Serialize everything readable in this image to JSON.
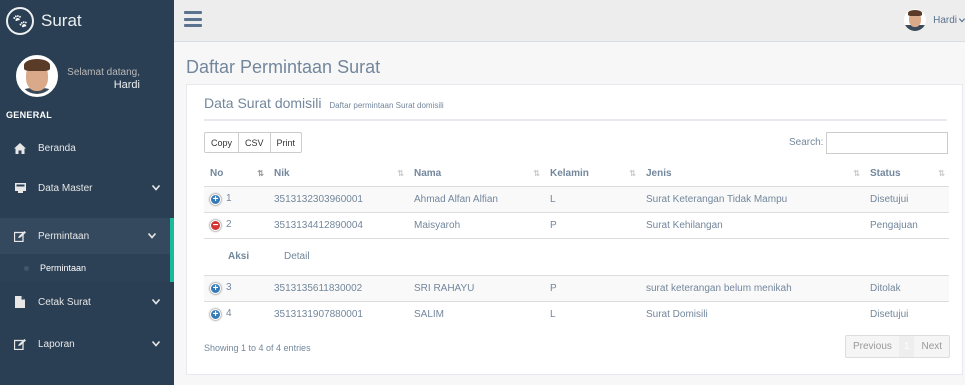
{
  "app": {
    "brand": "Surat",
    "logo_icon": "paw-icon"
  },
  "sidebar": {
    "welcome": "Selamat datang,",
    "username": "Hardi",
    "section": "GENERAL",
    "items": [
      {
        "label": "Beranda",
        "icon": "home-icon"
      },
      {
        "label": "Data Master",
        "icon": "desktop-icon"
      },
      {
        "label": "Permintaan",
        "icon": "edit-icon"
      },
      {
        "label": "Cetak Surat",
        "icon": "file-icon"
      },
      {
        "label": "Laporan",
        "icon": "edit-icon"
      }
    ],
    "sub_items": [
      {
        "label": "Permintaan"
      }
    ]
  },
  "topnav": {
    "user": "Hardi"
  },
  "page": {
    "title": "Daftar Permintaan Surat"
  },
  "panel": {
    "title": "Data Surat domisili",
    "subtitle": "Daftar permintaan Surat domisili",
    "buttons": [
      "Copy",
      "CSV",
      "Print"
    ],
    "search_label": "Search:"
  },
  "table": {
    "columns": [
      "No",
      "Nik",
      "Nama",
      "Kelamin",
      "Jenis",
      "Status"
    ],
    "rows": [
      {
        "no": "1",
        "nik": "3513132303960001",
        "nama": "Ahmad Alfan Alfian",
        "kelamin": "L",
        "jenis": "Surat Keterangan Tidak Mampu",
        "status": "Disetujui"
      },
      {
        "no": "2",
        "nik": "3513134412890004",
        "nama": "Maisyaroh",
        "kelamin": "P",
        "jenis": "Surat Kehilangan",
        "status": "Pengajuan"
      },
      {
        "no": "3",
        "nik": "3513135611830002",
        "nama": "SRI RAHAYU",
        "kelamin": "P",
        "jenis": "surat keterangan belum menikah",
        "status": "Ditolak"
      },
      {
        "no": "4",
        "nik": "3513131907880001",
        "nama": "SALIM",
        "kelamin": "L",
        "jenis": "Surat Domisili",
        "status": "Disetujui"
      }
    ],
    "child": {
      "label": "Aksi",
      "link": "Detail"
    }
  },
  "footer": {
    "info": "Showing 1 to 4 of 4 entries",
    "previous": "Previous",
    "current": "1",
    "next": "Next"
  },
  "colors": {
    "sidebar": "#2A3F54",
    "accent": "#1ABB9C",
    "expand": "#337AB7",
    "collapse": "#D33333"
  }
}
